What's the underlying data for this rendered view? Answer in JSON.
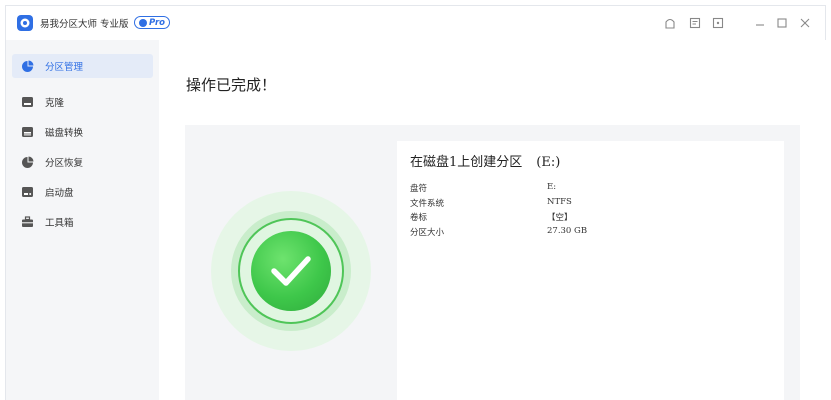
{
  "app": {
    "title": "易我分区大师 专业版",
    "badge": "Pro"
  },
  "titlebar_icons": [
    "skin-icon",
    "feedback-icon",
    "menu-icon",
    "minimize-icon",
    "maximize-icon",
    "close-icon"
  ],
  "sidebar": {
    "items": [
      {
        "label": "分区管理",
        "icon": "pie-chart-icon",
        "active": true
      },
      {
        "label": "克隆",
        "icon": "clone-icon",
        "active": false
      },
      {
        "label": "磁盘转换",
        "icon": "disk-convert-icon",
        "active": false
      },
      {
        "label": "分区恢复",
        "icon": "partition-recovery-icon",
        "active": false
      },
      {
        "label": "启动盘",
        "icon": "boot-disk-icon",
        "active": false
      },
      {
        "label": "工具箱",
        "icon": "toolbox-icon",
        "active": false
      }
    ]
  },
  "main": {
    "heading": "操作已完成！",
    "result": {
      "title": "在磁盘1上创建分区",
      "drive": "(E:)",
      "fields": [
        {
          "label": "盘符",
          "value": "E:"
        },
        {
          "label": "文件系统",
          "value": "NTFS"
        },
        {
          "label": "卷标",
          "value": "【空】"
        },
        {
          "label": "分区大小",
          "value": "27.30 GB"
        }
      ]
    }
  },
  "colors": {
    "accent": "#2f6fe4",
    "success": "#3ec74a",
    "sidebar_bg": "#f5f6f8",
    "panel_bg": "#f4f5f7"
  }
}
